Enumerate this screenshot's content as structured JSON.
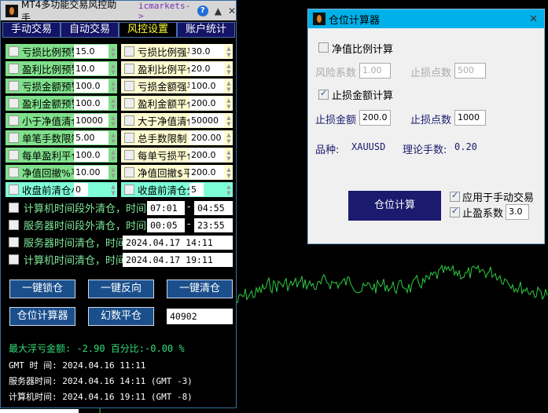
{
  "panel": {
    "title": "MT4多功能交易风控助手",
    "broker": "icmarkets->",
    "help": "?",
    "minimize": "▲",
    "close": "✕",
    "tabs": [
      "手动交易",
      "自动交易",
      "风控设置",
      "账户统计"
    ],
    "left": [
      {
        "label": "亏损比例预警",
        "value": "15.0"
      },
      {
        "label": "盈利比例预警",
        "value": "10.0"
      },
      {
        "label": "亏损金额预警",
        "value": "100.0"
      },
      {
        "label": "盈利金额预警",
        "value": "100.0"
      },
      {
        "label": "小于净值清仓",
        "value": "10000"
      },
      {
        "label": "单笔手数限制",
        "value": "5.00"
      },
      {
        "label": "每单盈利平仓",
        "value": "100.0"
      },
      {
        "label": "净值回撤%平",
        "value": "10.00"
      },
      {
        "label": "收盘前清仓小时",
        "value": "0"
      }
    ],
    "right": [
      {
        "label": "亏损比例强平",
        "value": "30.0"
      },
      {
        "label": "盈利比例平仓",
        "value": "20.0"
      },
      {
        "label": "亏损金额强平",
        "value": "100.0"
      },
      {
        "label": "盈利金额平仓",
        "value": "200.0"
      },
      {
        "label": "大于净值清仓",
        "value": "50000"
      },
      {
        "label": "总手数限制",
        "value": "200.00"
      },
      {
        "label": "每单亏损平仓",
        "value": "200.0"
      },
      {
        "label": "净值回撤$平",
        "value": "200.0"
      },
      {
        "label": "收盘前清仓分钟",
        "value": "5"
      }
    ],
    "time_rows": [
      {
        "label": "计算机时间段外清仓，时间段",
        "from": "07:01",
        "to": "04:55"
      },
      {
        "label": "服务器时间段外清仓，时间段",
        "from": "00:05",
        "to": "23:55"
      },
      {
        "label": "服务器时间清仓，时间:",
        "value": "2024.04.17 14:11"
      },
      {
        "label": "计算机时间清仓，时间:",
        "value": "2024.04.17 19:11"
      }
    ],
    "dash": "-",
    "buttons": [
      "一键锁仓",
      "一键反向",
      "一键清仓",
      "仓位计算器",
      "幻数平仓"
    ],
    "magic": "40902",
    "info": {
      "float_loss": "最大浮亏金额:  -2.90 百分比:-0.00 %",
      "gmt": " GMT 时 间: 2024.04.16 11:11",
      "server": "服务器时间: 2024.04.16 14:11 (GMT -3)",
      "local": "计算机时间: 2024.04.16 19:11 (GMT -8)"
    }
  },
  "calc": {
    "title": "仓位计算器",
    "close": "✕",
    "equity_ratio": "净值比例计算",
    "risk_label": "风险系数",
    "risk": "1.00",
    "sl_points_label": "止损点数",
    "sl_points_dis": "500",
    "sl_amount_calc": "止损金额计算",
    "sl_amount_label": "止损金额",
    "sl_amount": "200.0",
    "sl_points": "1000",
    "symbol_label": "品种:",
    "symbol": "XAUUSD",
    "lots_label": "理论手数:",
    "lots": "0.20",
    "calc_button": "仓位计算",
    "apply_manual": "应用于手动交易",
    "tp_ratio_label": "止盈系数",
    "tp_ratio": "3.0"
  }
}
